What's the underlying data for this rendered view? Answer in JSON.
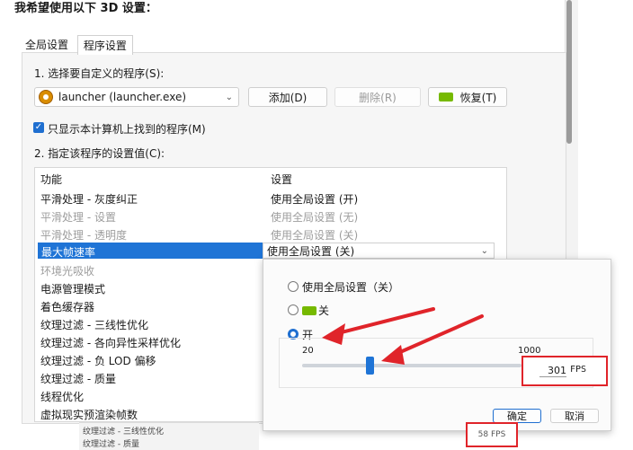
{
  "title": "我希望使用以下 3D 设置：",
  "tabs": [
    "全局设置",
    "程序设置"
  ],
  "step1": {
    "label": "1. 选择要自定义的程序(S):",
    "program": "launcher (launcher.exe)",
    "add_button": "添加(D)",
    "remove_button": "删除(R)",
    "restore_button": "恢复(T)"
  },
  "only_show_label": "只显示本计算机上找到的程序(M)",
  "step2": {
    "label": "2. 指定该程序的设置值(C):"
  },
  "table": {
    "headers": {
      "feature": "功能",
      "setting": "设置"
    },
    "rows": [
      {
        "feature": "平滑处理 - 灰度纠正",
        "setting": "使用全局设置 (开)",
        "dim": false
      },
      {
        "feature": "平滑处理 - 设置",
        "setting": "使用全局设置 (无)",
        "dim": true
      },
      {
        "feature": "平滑处理 - 透明度",
        "setting": "使用全局设置 (关)",
        "dim": true
      },
      {
        "feature": "最大帧速率",
        "setting": "使用全局设置 (关)",
        "dim": false,
        "selected": true
      },
      {
        "feature": "环境光吸收",
        "setting": "",
        "dim": true
      },
      {
        "feature": "电源管理模式",
        "setting": "",
        "dim": false
      },
      {
        "feature": "着色缓存器",
        "setting": "",
        "dim": false
      },
      {
        "feature": "纹理过滤 - 三线性优化",
        "setting": "",
        "dim": false
      },
      {
        "feature": "纹理过滤 - 各向异性采样优化",
        "setting": "",
        "dim": false
      },
      {
        "feature": "纹理过滤 - 负 LOD 偏移",
        "setting": "",
        "dim": false
      },
      {
        "feature": "纹理过滤 - 质量",
        "setting": "",
        "dim": false
      },
      {
        "feature": "线程优化",
        "setting": "",
        "dim": false
      },
      {
        "feature": "虚拟现实预渲染帧数",
        "setting": "",
        "dim": false
      }
    ]
  },
  "popup": {
    "opt_global": "使用全局设置（关）",
    "opt_off": "关",
    "opt_on": "开",
    "selected": "on",
    "slider": {
      "min_label": "20",
      "max_label": "1000",
      "min": 20,
      "max": 1000,
      "value": 301
    },
    "fps_value": "301",
    "fps_unit": "FPS",
    "ok_button": "确定",
    "cancel_button": "取消"
  },
  "background": {
    "row_a": "纹理过滤 - 三线性优化",
    "row_b": "纹理过滤 - 质量",
    "fps_text": "58 FPS"
  },
  "colors": {
    "accent": "#1f74d6",
    "highlight_red": "#e0242a",
    "nvidia_green": "#76b900"
  }
}
